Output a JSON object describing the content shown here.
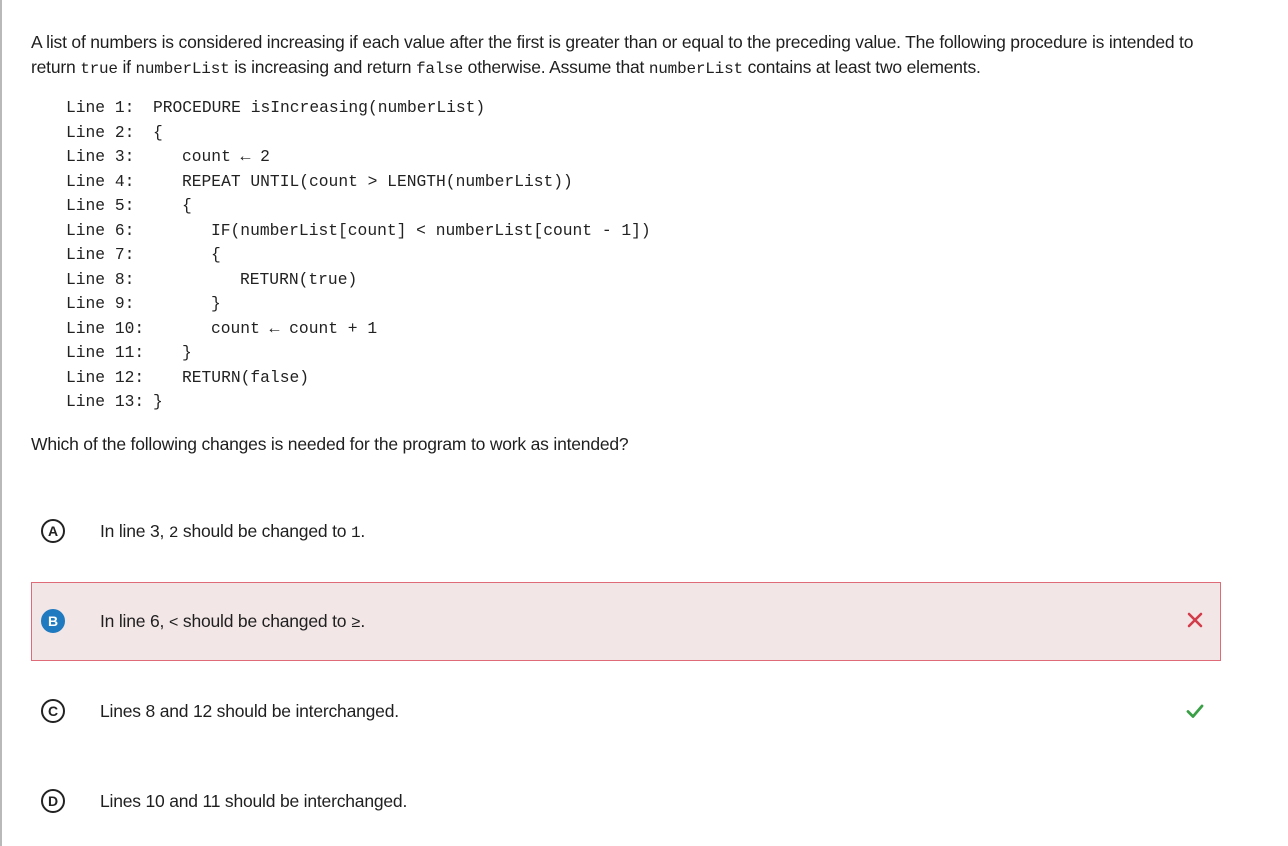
{
  "question": {
    "p1": "A list of numbers is considered increasing if each value after the first is greater than or equal to the preceding value. The following procedure is intended to return",
    "c1": "true",
    "p2": "if",
    "c2": "numberList",
    "p3": "is increasing and return",
    "c3": "false",
    "p4": "otherwise. Assume that",
    "c4": "numberList",
    "p5": "contains at least two elements."
  },
  "code_lines": [
    {
      "num": "Line 1:",
      "code": "PROCEDURE isIncreasing(numberList)"
    },
    {
      "num": "Line 2:",
      "code": "{"
    },
    {
      "num": "Line 3:",
      "code": "count ← 2"
    },
    {
      "num": "Line 4:",
      "code": "REPEAT UNTIL(count > LENGTH(numberList))"
    },
    {
      "num": "Line 5:",
      "code": "{"
    },
    {
      "num": "Line 6:",
      "code": "IF(numberList[count] < numberList[count - 1])"
    },
    {
      "num": "Line 7:",
      "code": "{"
    },
    {
      "num": "Line 8:",
      "code": "RETURN(true)"
    },
    {
      "num": "Line 9:",
      "code": "}"
    },
    {
      "num": "Line 10:",
      "code": "count ← count + 1"
    },
    {
      "num": "Line 11:",
      "code": "}"
    },
    {
      "num": "Line 12:",
      "code": "RETURN(false)"
    },
    {
      "num": "Line 13:",
      "code": "}"
    }
  ],
  "prompt": "Which of the following changes is needed for the program to work as intended?",
  "options": [
    {
      "letter": "A",
      "t1": "In line 3,",
      "c1": "2",
      "t2": "should be changed to",
      "c2": "1",
      "t3": "."
    },
    {
      "letter": "B",
      "t1": "In line 6,",
      "c1": "<",
      "t2": "should be changed to",
      "c2": "≥",
      "t3": ".",
      "state": "selected-incorrect"
    },
    {
      "letter": "C",
      "text": "Lines 8 and 12 should be interchanged.",
      "state": "correct"
    },
    {
      "letter": "D",
      "text": "Lines 10 and 11 should be interchanged."
    }
  ],
  "icons": {
    "incorrect": "close-icon",
    "correct": "checkmark-icon"
  },
  "colors": {
    "selected_bg": "#f3e6e7",
    "selected_border": "#e06b78",
    "incorrect_mark": "#d23c4b",
    "correct_mark": "#3aa046",
    "badge_selected": "#1f7ac0"
  }
}
